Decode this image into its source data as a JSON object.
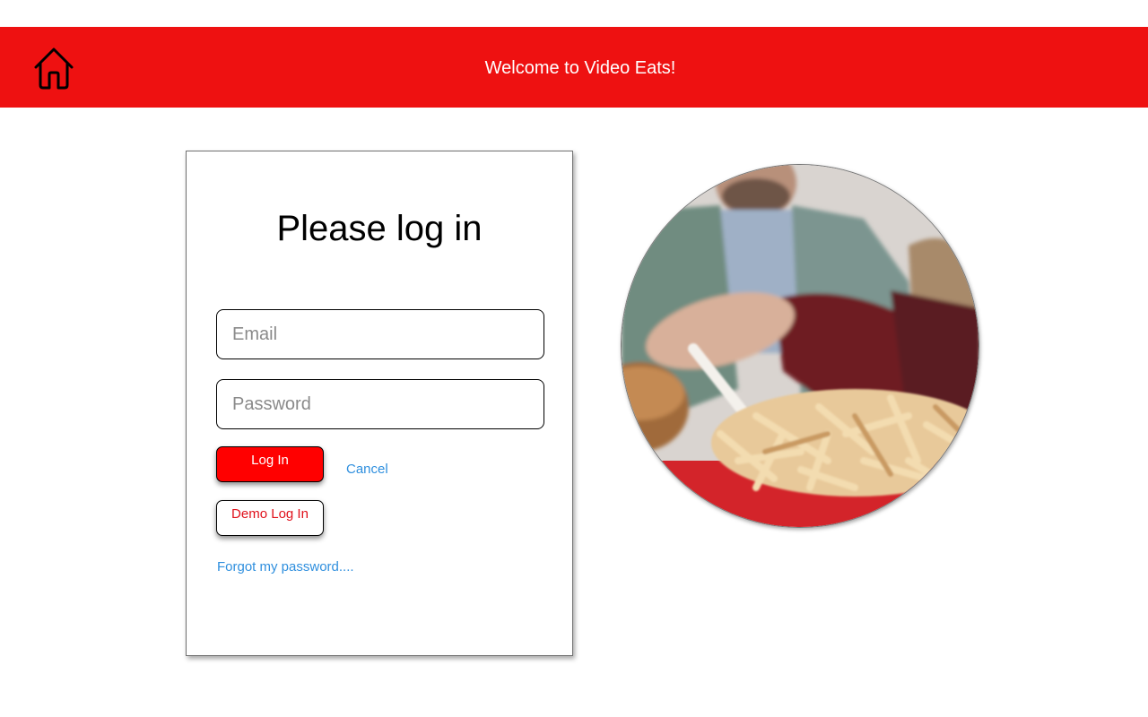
{
  "header": {
    "title": "Welcome to Video Eats!",
    "background_color": "#ee1111",
    "home_icon": "home-icon"
  },
  "login_card": {
    "title": "Please log in",
    "email_placeholder": "Email",
    "email_value": "",
    "password_placeholder": "Password",
    "password_value": "",
    "login_label": "Log In",
    "cancel_label": "Cancel",
    "demo_login_label": "Demo Log In",
    "forgot_password_label": "Forgot my password....",
    "login_button_color": "#ff0000",
    "link_color": "#2f8fde"
  },
  "hero_image": {
    "subject": "food-photo"
  }
}
